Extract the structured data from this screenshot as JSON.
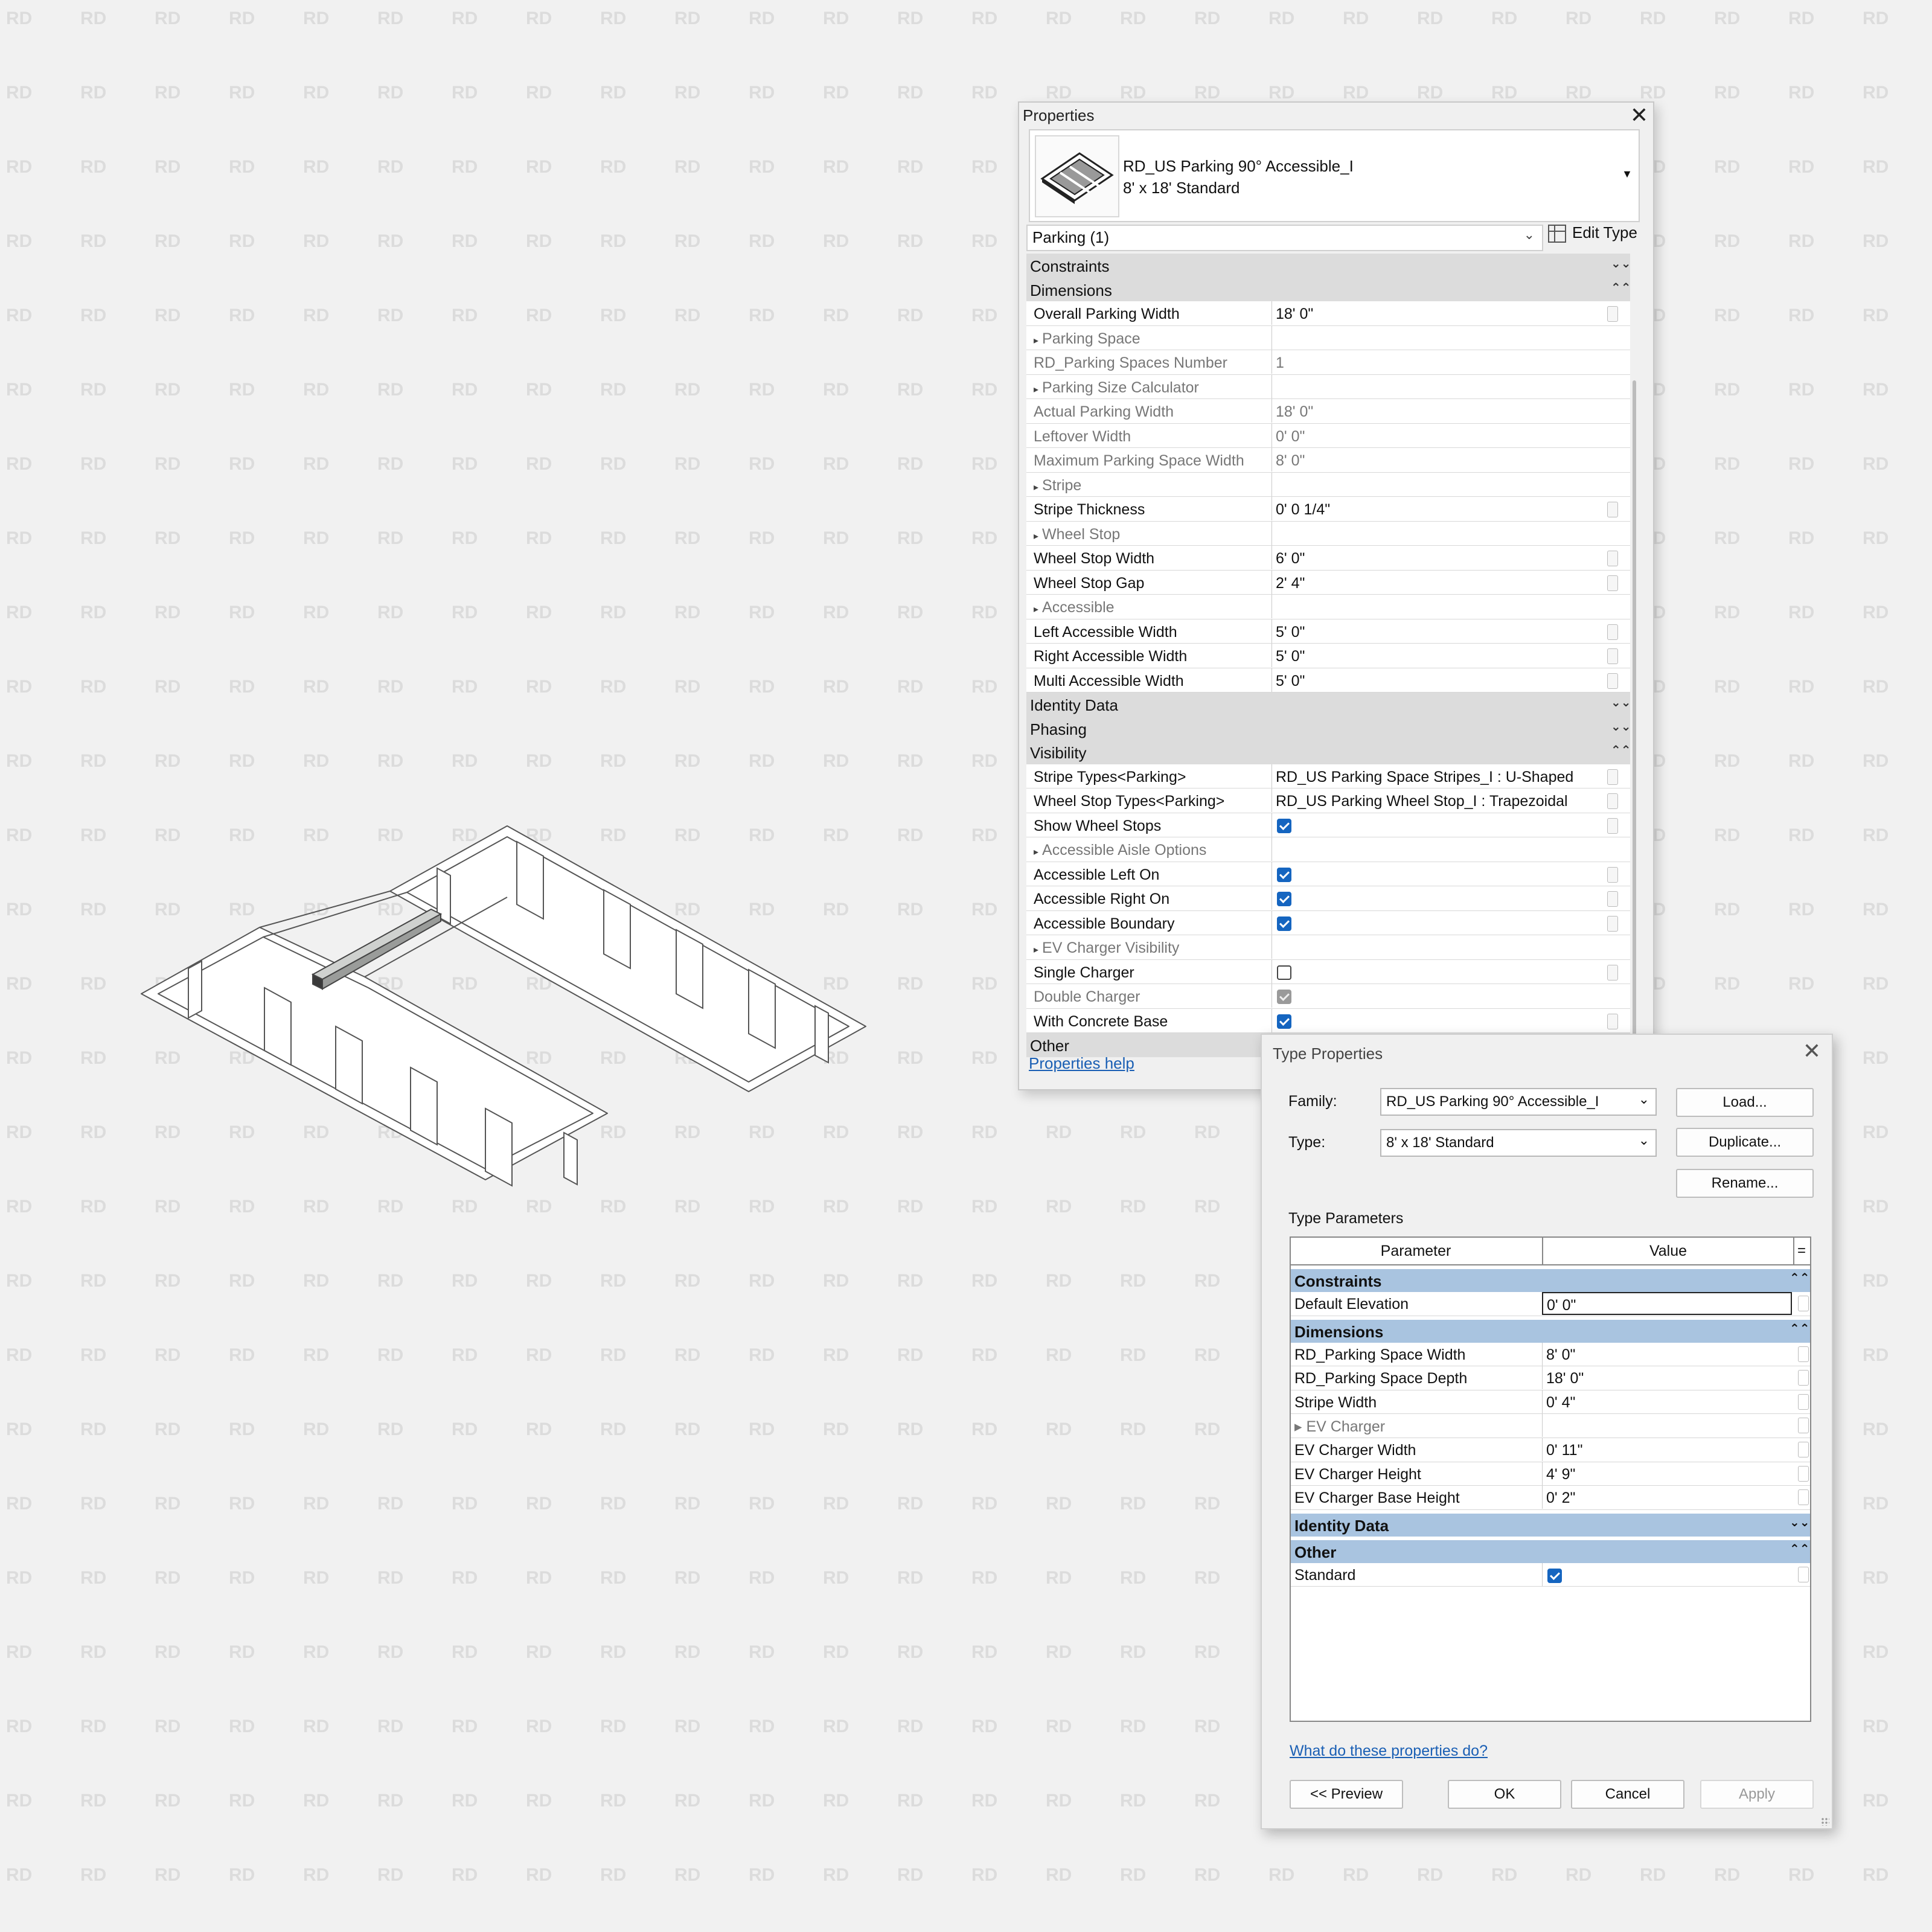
{
  "watermark": "RD",
  "properties_palette": {
    "title": "Properties",
    "close_label": "✕",
    "type_selector": {
      "family": "RD_US Parking 90° Accessible_I",
      "type": "8' x 18' Standard"
    },
    "instance_filter": "Parking (1)",
    "edit_type_label": "Edit Type",
    "help_link": "Properties help",
    "groups": [
      {
        "name": "Constraints",
        "chevron": "⌄⌄",
        "rows": []
      },
      {
        "name": "Dimensions",
        "chevron": "⌃⌃",
        "rows": [
          {
            "name": "Overall Parking Width",
            "value": "18'  0\"",
            "kind": "text"
          },
          {
            "name": "Parking Space",
            "value": "",
            "kind": "sub"
          },
          {
            "name": "RD_Parking Spaces Number",
            "value": "1",
            "kind": "grey"
          },
          {
            "name": "Parking Size Calculator",
            "value": "",
            "kind": "sub"
          },
          {
            "name": "Actual Parking Width",
            "value": "18'  0\"",
            "kind": "grey"
          },
          {
            "name": "Leftover Width",
            "value": "0'  0\"",
            "kind": "grey"
          },
          {
            "name": "Maximum Parking Space Width",
            "value": "8'  0\"",
            "kind": "grey"
          },
          {
            "name": "Stripe",
            "value": "",
            "kind": "sub"
          },
          {
            "name": "Stripe Thickness",
            "value": "0'  0 1/4\"",
            "kind": "text"
          },
          {
            "name": "Wheel Stop",
            "value": "",
            "kind": "sub"
          },
          {
            "name": "Wheel Stop Width",
            "value": "6'  0\"",
            "kind": "text"
          },
          {
            "name": "Wheel Stop Gap",
            "value": "2'  4\"",
            "kind": "text"
          },
          {
            "name": "Accessible",
            "value": "",
            "kind": "sub"
          },
          {
            "name": "Left Accessible Width",
            "value": "5'  0\"",
            "kind": "text"
          },
          {
            "name": "Right Accessible Width",
            "value": "5'  0\"",
            "kind": "text"
          },
          {
            "name": "Multi Accessible Width",
            "value": "5'  0\"",
            "kind": "text"
          }
        ]
      },
      {
        "name": "Identity Data",
        "chevron": "⌄⌄",
        "rows": []
      },
      {
        "name": "Phasing",
        "chevron": "⌄⌄",
        "rows": []
      },
      {
        "name": "Visibility",
        "chevron": "⌃⌃",
        "rows": [
          {
            "name": "Stripe Types<Parking>",
            "value": "RD_US Parking Space Stripes_I : U-Shaped",
            "kind": "text"
          },
          {
            "name": "Wheel Stop Types<Parking>",
            "value": "RD_US Parking Wheel Stop_I : Trapezoidal",
            "kind": "text"
          },
          {
            "name": "Show Wheel Stops",
            "value": "checked",
            "kind": "check"
          },
          {
            "name": "Accessible Aisle Options",
            "value": "",
            "kind": "sub"
          },
          {
            "name": "Accessible Left On",
            "value": "checked",
            "kind": "check"
          },
          {
            "name": "Accessible Right On",
            "value": "checked",
            "kind": "check"
          },
          {
            "name": "Accessible Boundary",
            "value": "checked",
            "kind": "check"
          },
          {
            "name": "EV Charger Visibility",
            "value": "",
            "kind": "sub"
          },
          {
            "name": "Single Charger",
            "value": "unchecked",
            "kind": "check"
          },
          {
            "name": "Double Charger",
            "value": "disabled",
            "kind": "check",
            "grey": true
          },
          {
            "name": "With Concrete Base",
            "value": "checked",
            "kind": "check"
          }
        ]
      },
      {
        "name": "Other",
        "chevron": "⌄⌄",
        "rows": []
      }
    ]
  },
  "type_properties": {
    "title": "Type Properties",
    "close_label": "✕",
    "family_label": "Family:",
    "family_value": "RD_US Parking 90° Accessible_I",
    "type_label": "Type:",
    "type_value": "8' x 18' Standard",
    "load_button": "Load...",
    "duplicate_button": "Duplicate...",
    "rename_button": "Rename...",
    "section_label": "Type Parameters",
    "col_parameter": "Parameter",
    "col_value": "Value",
    "col_formula": "=",
    "groups": [
      {
        "name": "Constraints",
        "chevron": "⌃⌃",
        "rows": [
          {
            "name": "Default Elevation",
            "value": "0'  0\"",
            "kind": "edit"
          }
        ]
      },
      {
        "name": "Dimensions",
        "chevron": "⌃⌃",
        "rows": [
          {
            "name": "RD_Parking Space Width",
            "value": "8'  0\"",
            "kind": "text"
          },
          {
            "name": "RD_Parking Space Depth",
            "value": "18'  0\"",
            "kind": "text"
          },
          {
            "name": "Stripe Width",
            "value": "0'  4\"",
            "kind": "text"
          },
          {
            "name": "EV Charger",
            "value": "",
            "kind": "sub"
          },
          {
            "name": "EV Charger Width",
            "value": "0'  11\"",
            "kind": "text"
          },
          {
            "name": "EV Charger Height",
            "value": "4'  9\"",
            "kind": "text"
          },
          {
            "name": "EV Charger Base Height",
            "value": "0'  2\"",
            "kind": "text"
          }
        ]
      },
      {
        "name": "Identity Data",
        "chevron": "⌄⌄",
        "rows": []
      },
      {
        "name": "Other",
        "chevron": "⌃⌃",
        "rows": [
          {
            "name": "Standard",
            "value": "checked",
            "kind": "check"
          }
        ]
      }
    ],
    "help_link": "What do these properties do?",
    "preview_button": "<< Preview",
    "ok_button": "OK",
    "cancel_button": "Cancel",
    "apply_button": "Apply"
  },
  "colors": {
    "accent": "#1565c0",
    "category_band": "#dcdcdc",
    "type_category_band": "#a9c4e0",
    "link": "#1a5fb4"
  }
}
